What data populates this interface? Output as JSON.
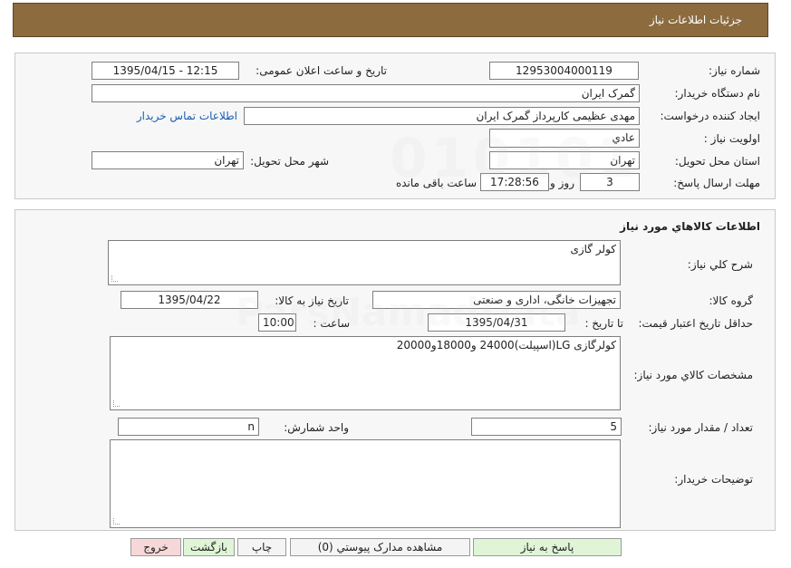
{
  "header": {
    "title": "جزئیات اطلاعات نیاز"
  },
  "info": {
    "need_number_label": "شماره نیاز:",
    "need_number": "12953004000119",
    "announce_label": "تاریخ و ساعت اعلان عمومی:",
    "announce_value": "1395/04/15 - 12:15",
    "buyer_org_label": "نام دستگاه خریدار:",
    "buyer_org": "گمرک ایران",
    "creator_label": "ایجاد کننده درخواست:",
    "creator": "مهدی عظیمی کارپرداز گمرک ایران",
    "contact_link": "اطلاعات تماس خریدار",
    "priority_label": "اولویت نیاز :",
    "priority": "عادي",
    "province_label": "استان محل تحویل:",
    "province": "تهران",
    "city_label": "شهر محل تحویل:",
    "city": "تهران",
    "deadline_label": "مهلت ارسال پاسخ:",
    "days": "3",
    "days_label": "روز و",
    "time": "17:28:56",
    "remaining_label": "ساعت باقی مانده"
  },
  "goods": {
    "title": "اطلاعات کالاهاي مورد نياز",
    "desc_label": "شرح کلي نياز:",
    "desc": "کولر گازی",
    "group_label": "گروه کالا:",
    "group": "تجهیزات خانگی، اداری و صنعتی",
    "need_date_label": "تاریخ نیاز به کالا:",
    "need_date": "1395/04/22",
    "validity_label": "حداقل تاریخ اعتبار قیمت:",
    "to_date_label": "تا تاریخ :",
    "to_date": "1395/04/31",
    "hour_label": "ساعت :",
    "hour": "10:00",
    "spec_label": "مشخصات کالاي مورد نياز:",
    "spec": "کولرگازی LG(اسپیلت)24000 و18000و20000",
    "qty_label": "تعداد / مقدار مورد نیاز:",
    "qty": "5",
    "unit_label": "واحد شمارش:",
    "unit": "n",
    "notes_label": "توضیحات خریدار:",
    "notes": ""
  },
  "buttons": {
    "reply": "پاسخ به نیاز",
    "attachments": "مشاهده مدارک پیوستي (0)",
    "print": "چاپ",
    "back": "بازگشت",
    "exit": "خروج"
  },
  "colors": {
    "header_bg": "#8c6b3f",
    "green_button": "#dff5d6",
    "red_button": "#f7d8d8",
    "link": "#1b5fb0"
  }
}
